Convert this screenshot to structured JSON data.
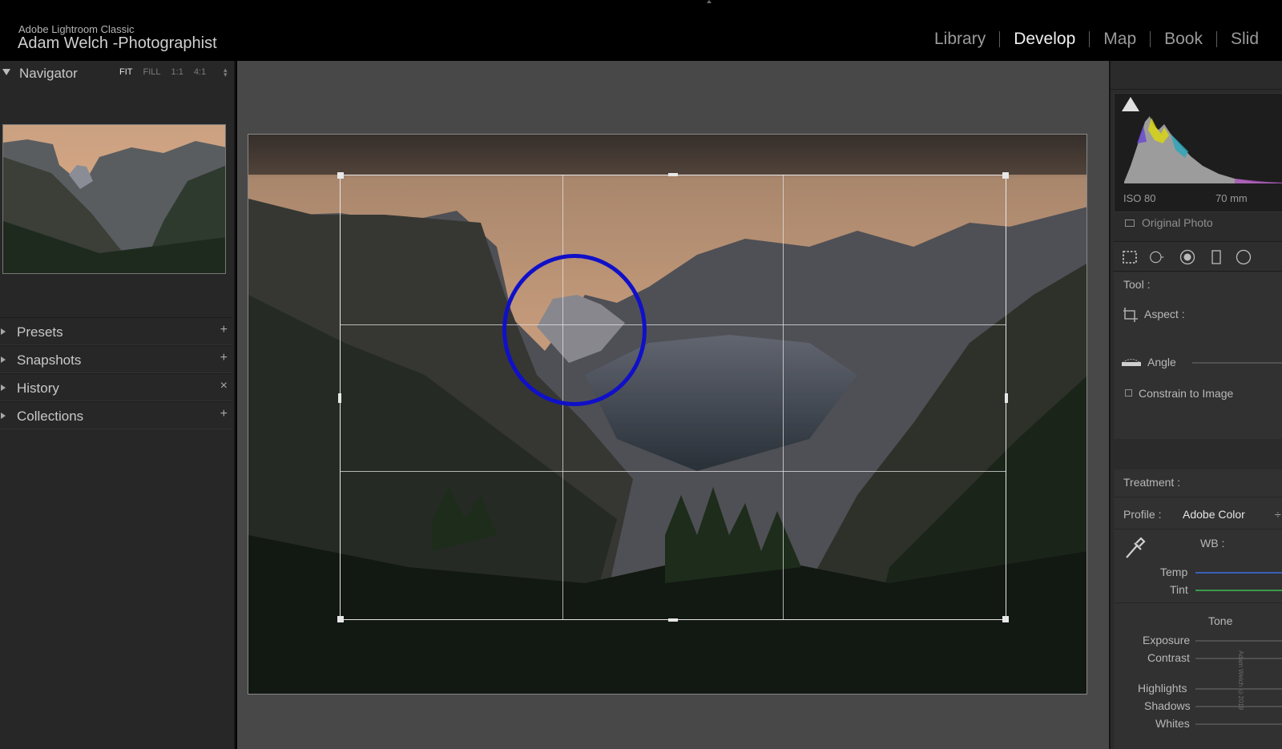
{
  "header": {
    "app_name": "Adobe Lightroom Classic",
    "owner": "Adam Welch -Photographist",
    "modules": [
      {
        "label": "Library",
        "active": false
      },
      {
        "label": "Develop",
        "active": true
      },
      {
        "label": "Map",
        "active": false
      },
      {
        "label": "Book",
        "active": false
      },
      {
        "label": "Slid",
        "active": false
      }
    ]
  },
  "left_panel": {
    "navigator": {
      "title": "Navigator",
      "zoom_options": [
        "FIT",
        "FILL",
        "1:1",
        "4:1"
      ],
      "active_zoom": "FIT",
      "arrows": "▲▼"
    },
    "sections": [
      {
        "label": "Presets",
        "action": "+"
      },
      {
        "label": "Snapshots",
        "action": "+"
      },
      {
        "label": "History",
        "action": "×"
      },
      {
        "label": "Collections",
        "action": "+"
      }
    ]
  },
  "right_panel": {
    "histogram": {
      "iso": "ISO 80",
      "focal": "70 mm"
    },
    "original_photo": "Original Photo",
    "tool_label": "Tool :",
    "aspect_label": "Aspect :",
    "angle_label": "Angle",
    "constrain_label": "Constrain to Image",
    "treatment_label": "Treatment :",
    "profile_label": "Profile :",
    "profile_value": "Adobe Color",
    "profile_arrows": "÷",
    "wb_label": "WB :",
    "temp_label": "Temp",
    "tint_label": "Tint",
    "tone_label": "Tone",
    "exposure_label": "Exposure",
    "contrast_label": "Contrast",
    "highlights_label": "Highlights",
    "shadows_label": "Shadows",
    "whites_label": "Whites",
    "watermark": "Adam Welch ©2019"
  },
  "colors": {
    "annotation_circle": "#1010c8",
    "temp_slider": "#3a5fb5",
    "tint_slider": "#3a9a48"
  }
}
